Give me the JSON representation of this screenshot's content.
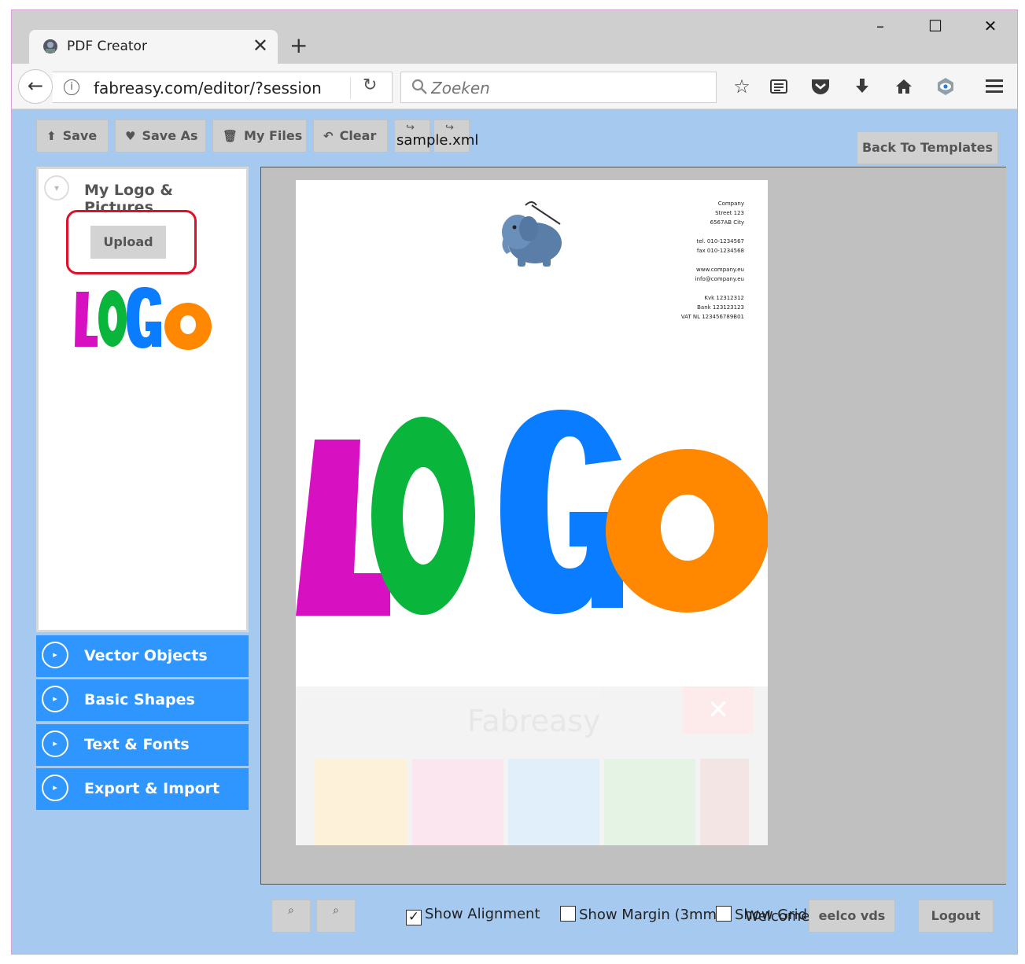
{
  "browser": {
    "tab_title": "PDF Creator",
    "new_tab": "+",
    "url": "fabreasy.com/editor/?session=M",
    "search_placeholder": "Zoeken"
  },
  "toolbar": {
    "save": "Save",
    "save_as": "Save As",
    "my_files": "My Files",
    "clear": "Clear",
    "xml_file": "sample.xml",
    "back_to_templates": "Back To Templates"
  },
  "sidebar": {
    "section_title": "My Logo & Pictures",
    "upload": "Upload",
    "accordion": [
      {
        "label": "Vector Objects"
      },
      {
        "label": "Basic Shapes"
      },
      {
        "label": "Text & Fonts"
      },
      {
        "label": "Export & Import"
      }
    ]
  },
  "letterhead": {
    "company": "Company",
    "street": "Street 123",
    "city": "6567AB City",
    "tel": "tel. 010-1234567",
    "fax": "fax 010-1234568",
    "web": "www.company.eu",
    "email": "info@company.eu",
    "kvk": "Kvk 12312312",
    "bank": "Bank 123123123",
    "vat": "VAT NL 123456789B01"
  },
  "overlay": {
    "title": "Fabreasy"
  },
  "bottom": {
    "show_alignment": "Show Alignment",
    "show_margin": "Show Margin (3mm)",
    "show_grid": "Show Grid",
    "welcome": "Welcome",
    "user": "eelco vds",
    "logout": "Logout",
    "show_alignment_checked": true,
    "show_margin_checked": false,
    "show_grid_checked": false
  },
  "colors": {
    "app_bg": "#a6c9f0",
    "accordion": "#2f95ff",
    "logo_l": "#d710c2",
    "logo_o": "#0ab53b",
    "logo_g": "#0a7cff",
    "logo_o2": "#ff8800",
    "highlight": "#e0102a"
  }
}
